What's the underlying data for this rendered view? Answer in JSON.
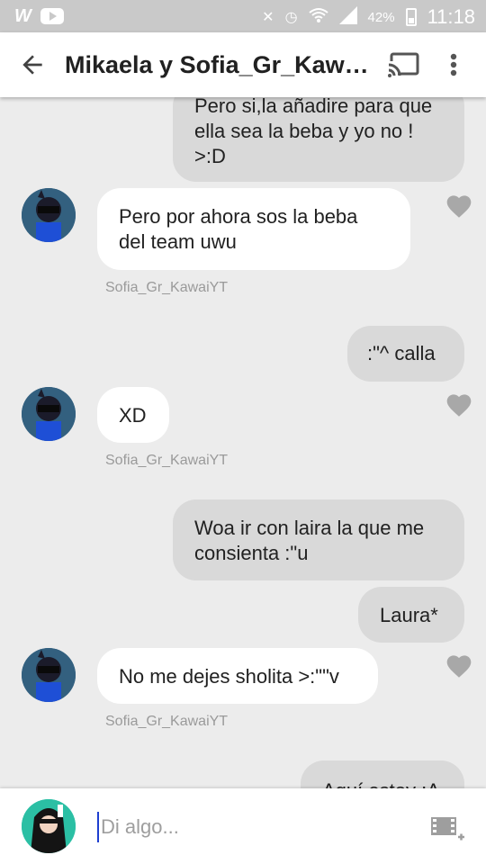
{
  "status_bar": {
    "battery": "42%",
    "time": "11:18"
  },
  "header": {
    "title": "Mikaela y Sofia_Gr_Kaw…"
  },
  "messages": [
    {
      "text": "Pero si,la añadire para que ella sea la beba y yo no ! >:D"
    },
    {
      "text": "Pero por ahora sos la beba del team uwu",
      "sender": "Sofia_Gr_KawaiYT"
    },
    {
      "text": ":\"^ calla"
    },
    {
      "text": "XD",
      "sender": "Sofia_Gr_KawaiYT"
    },
    {
      "text": "Woa ir con laira la que me consienta :\"u"
    },
    {
      "text": "Laura*"
    },
    {
      "text": "No me dejes sholita >:\"\"v",
      "sender": "Sofia_Gr_KawaiYT"
    },
    {
      "text": "Aquí estoy :A"
    }
  ],
  "composer": {
    "placeholder": "Di algo..."
  },
  "icons": [
    "back-arrow-icon",
    "cast-icon",
    "more-vert-icon",
    "heart-icon",
    "media-add-icon",
    "wifi-icon",
    "signal-icon",
    "battery-icon"
  ]
}
